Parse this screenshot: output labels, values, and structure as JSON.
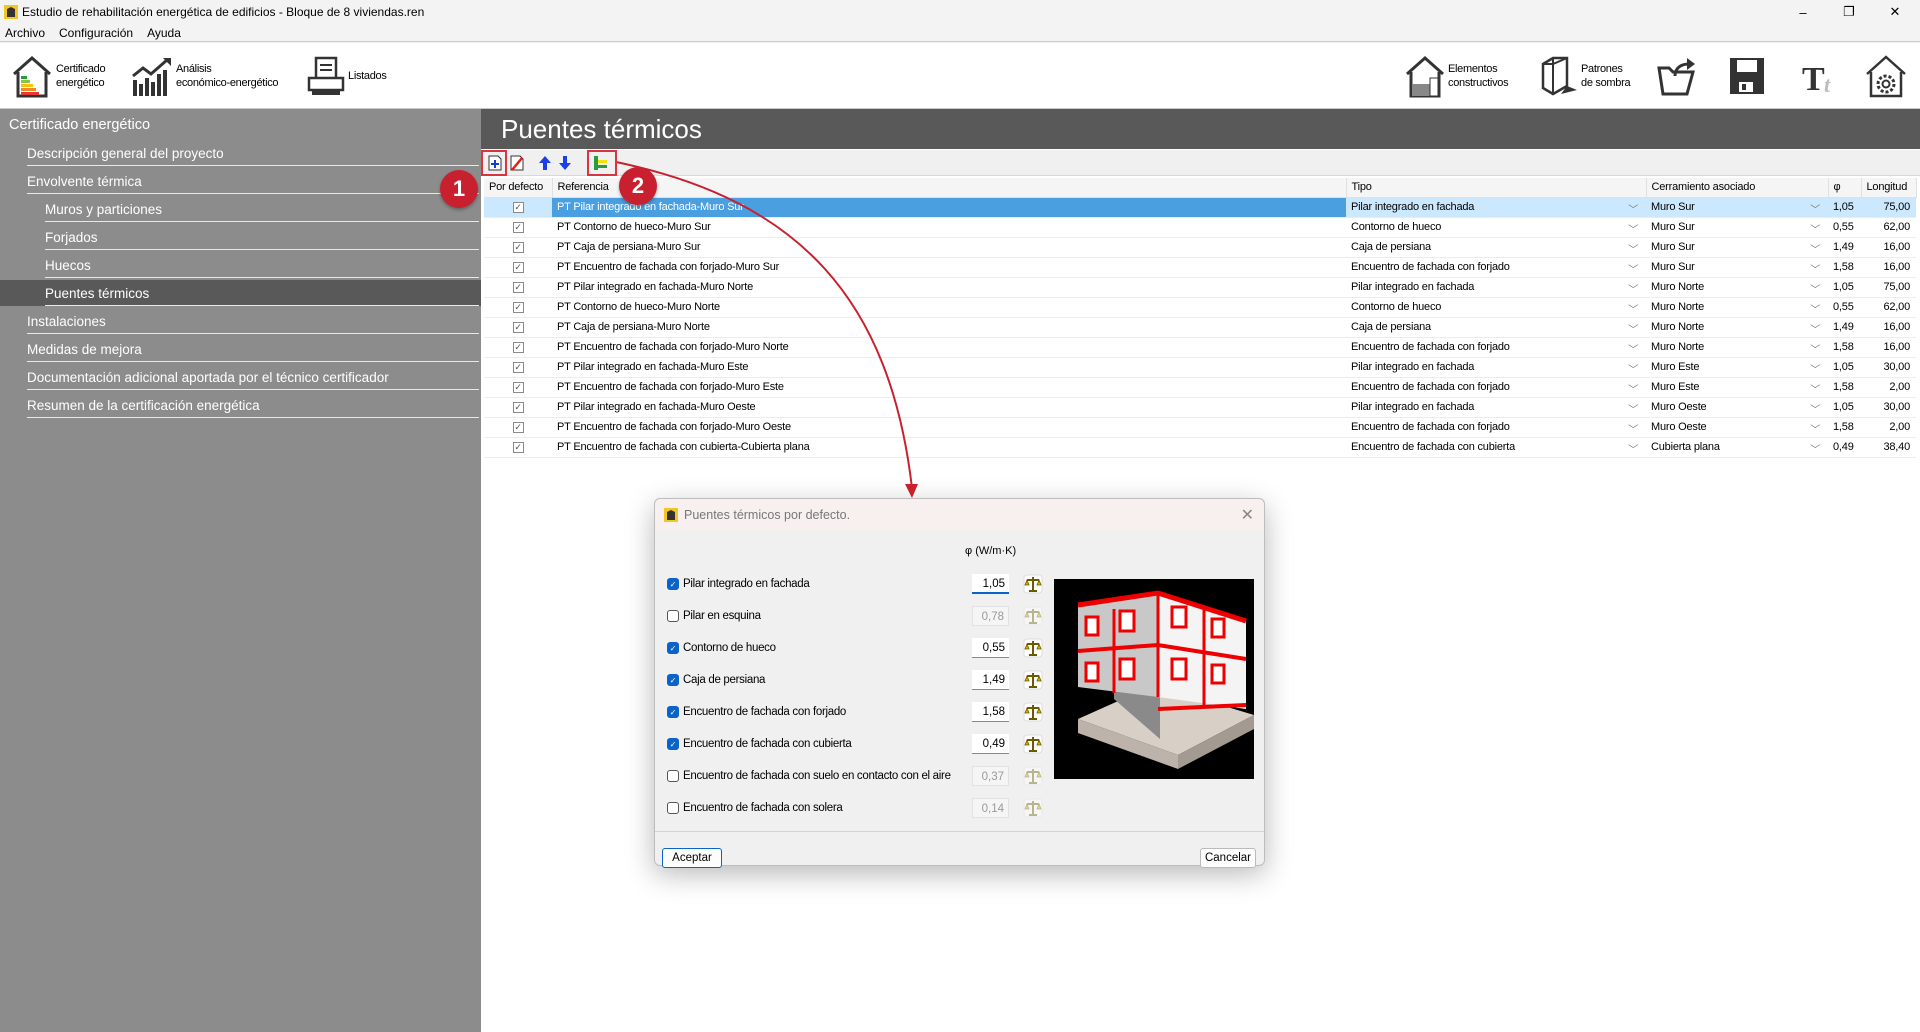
{
  "window": {
    "title": "Estudio de rehabilitación energética de edificios - Bloque de 8 viviendas.ren",
    "minimize": "–",
    "maximize": "❐",
    "close": "✕"
  },
  "menu": [
    "Archivo",
    "Configuración",
    "Ayuda"
  ],
  "toolbar": {
    "left": [
      {
        "label1": "Certificado",
        "label2": "energético",
        "icon": "energy-certificate-icon"
      },
      {
        "label1": "Análisis",
        "label2": "económico-energético",
        "icon": "analysis-chart-icon"
      },
      {
        "label1": "Listados",
        "label2": "",
        "icon": "printer-icon"
      }
    ],
    "right": [
      {
        "label1": "Elementos",
        "label2": "constructivos",
        "icon": "house-brick-icon"
      },
      {
        "label1": "Patrones",
        "label2": "de sombra",
        "icon": "shadow-box-icon"
      },
      {
        "icon": "open-folder-icon"
      },
      {
        "icon": "save-icon"
      },
      {
        "icon": "text-style-icon"
      },
      {
        "icon": "settings-gear-icon"
      }
    ]
  },
  "sidebar": {
    "header": "Certificado energético",
    "items": [
      {
        "label": "Descripción general del proyecto",
        "level": 1
      },
      {
        "label": "Envolvente térmica",
        "level": 1
      },
      {
        "label": "Muros y particiones",
        "level": 2
      },
      {
        "label": "Forjados",
        "level": 2
      },
      {
        "label": "Huecos",
        "level": 2
      },
      {
        "label": "Puentes térmicos",
        "level": 2,
        "selected": true
      },
      {
        "label": "Instalaciones",
        "level": 1
      },
      {
        "label": "Medidas de mejora",
        "level": 1
      },
      {
        "label": "Documentación adicional aportada por el técnico certificador",
        "level": 1
      },
      {
        "label": "Resumen de la certificación energética",
        "level": 1
      }
    ]
  },
  "main": {
    "title": "Puentes térmicos",
    "tools": [
      "add-icon",
      "delete-icon",
      "move-up-icon",
      "move-down-icon",
      "default-bridges-icon"
    ],
    "columns": [
      "Por defecto",
      "Referencia",
      "Tipo",
      "Cerramiento asociado",
      "φ",
      "Longitud"
    ],
    "rows": [
      {
        "default": true,
        "ref": "PT Pilar integrado en fachada-Muro Sur",
        "tipo": "Pilar integrado en fachada",
        "cerr": "Muro Sur",
        "phi": "1,05",
        "len": "75,00",
        "selected": true
      },
      {
        "default": true,
        "ref": "PT Contorno de hueco-Muro Sur",
        "tipo": "Contorno de hueco",
        "cerr": "Muro Sur",
        "phi": "0,55",
        "len": "62,00"
      },
      {
        "default": true,
        "ref": "PT Caja de persiana-Muro Sur",
        "tipo": "Caja de persiana",
        "cerr": "Muro Sur",
        "phi": "1,49",
        "len": "16,00"
      },
      {
        "default": true,
        "ref": "PT Encuentro de fachada con forjado-Muro Sur",
        "tipo": "Encuentro de fachada con forjado",
        "cerr": "Muro Sur",
        "phi": "1,58",
        "len": "16,00"
      },
      {
        "default": true,
        "ref": "PT Pilar integrado en fachada-Muro Norte",
        "tipo": "Pilar integrado en fachada",
        "cerr": "Muro Norte",
        "phi": "1,05",
        "len": "75,00"
      },
      {
        "default": true,
        "ref": "PT Contorno de hueco-Muro Norte",
        "tipo": "Contorno de hueco",
        "cerr": "Muro Norte",
        "phi": "0,55",
        "len": "62,00"
      },
      {
        "default": true,
        "ref": "PT Caja de persiana-Muro Norte",
        "tipo": "Caja de persiana",
        "cerr": "Muro Norte",
        "phi": "1,49",
        "len": "16,00"
      },
      {
        "default": true,
        "ref": "PT Encuentro de fachada con forjado-Muro Norte",
        "tipo": "Encuentro de fachada con forjado",
        "cerr": "Muro Norte",
        "phi": "1,58",
        "len": "16,00"
      },
      {
        "default": true,
        "ref": "PT Pilar integrado en fachada-Muro Este",
        "tipo": "Pilar integrado en fachada",
        "cerr": "Muro Este",
        "phi": "1,05",
        "len": "30,00"
      },
      {
        "default": true,
        "ref": "PT Encuentro de fachada con forjado-Muro Este",
        "tipo": "Encuentro de fachada con forjado",
        "cerr": "Muro Este",
        "phi": "1,58",
        "len": "2,00"
      },
      {
        "default": true,
        "ref": "PT Pilar integrado en fachada-Muro Oeste",
        "tipo": "Pilar integrado en fachada",
        "cerr": "Muro Oeste",
        "phi": "1,05",
        "len": "30,00"
      },
      {
        "default": true,
        "ref": "PT Encuentro de fachada con forjado-Muro Oeste",
        "tipo": "Encuentro de fachada con forjado",
        "cerr": "Muro Oeste",
        "phi": "1,58",
        "len": "2,00"
      },
      {
        "default": true,
        "ref": "PT Encuentro de fachada con cubierta-Cubierta plana",
        "tipo": "Encuentro de fachada con cubierta",
        "cerr": "Cubierta plana",
        "phi": "0,49",
        "len": "38,40"
      }
    ]
  },
  "dialog": {
    "title": "Puentes térmicos por defecto.",
    "phi_header": "φ (W/m·K)",
    "items": [
      {
        "label": "Pilar integrado en fachada",
        "checked": true,
        "value": "1,05"
      },
      {
        "label": "Pilar en esquina",
        "checked": false,
        "value": "0,78"
      },
      {
        "label": "Contorno de hueco",
        "checked": true,
        "value": "0,55"
      },
      {
        "label": "Caja de persiana",
        "checked": true,
        "value": "1,49"
      },
      {
        "label": "Encuentro de fachada con forjado",
        "checked": true,
        "value": "1,58"
      },
      {
        "label": "Encuentro de fachada con cubierta",
        "checked": true,
        "value": "0,49"
      },
      {
        "label": "Encuentro de fachada con suelo en contacto con el aire",
        "checked": false,
        "value": "0,37"
      },
      {
        "label": "Encuentro de fachada con solera",
        "checked": false,
        "value": "0,14"
      }
    ],
    "accept": "Aceptar",
    "cancel": "Cancelar"
  },
  "annotations": {
    "c1": "1",
    "c2": "2",
    "color": "#c8202e"
  },
  "colors": {
    "sidebar": "#8c8c8c",
    "header": "#595959",
    "selection": "#4a9fe0",
    "checkbox": "#0a63c9"
  }
}
